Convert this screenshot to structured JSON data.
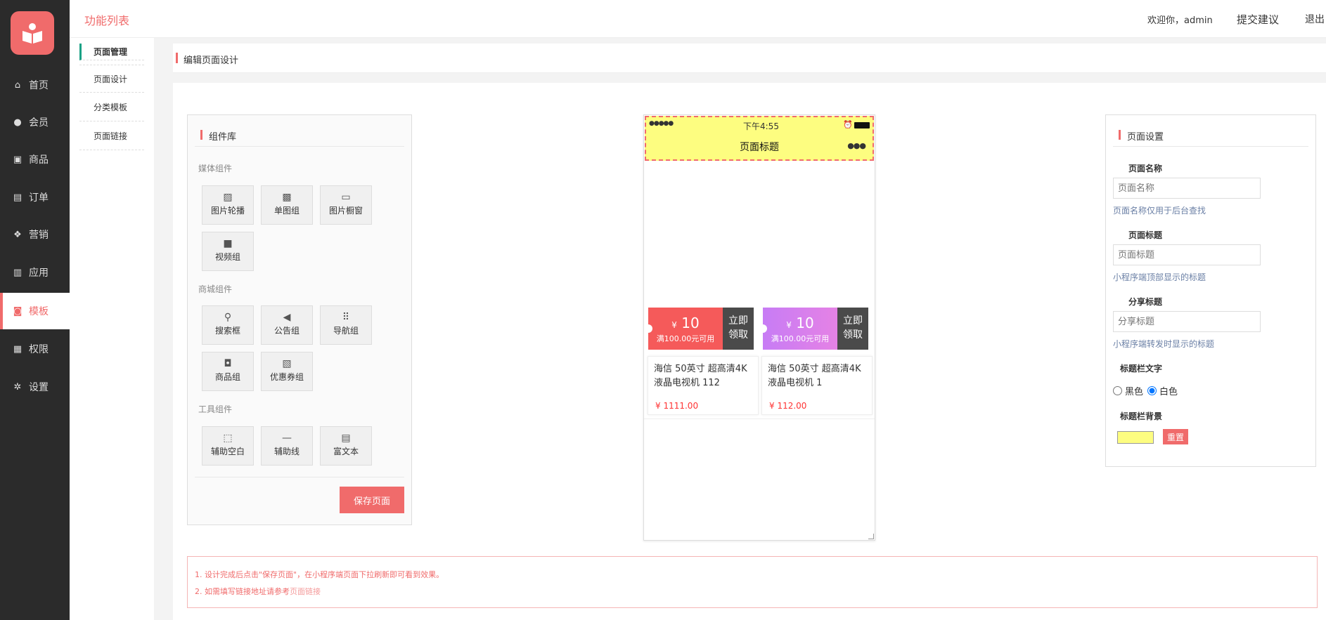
{
  "sidebar": {
    "logo_icon": "book-icon",
    "items": [
      {
        "label": "首页",
        "icon": "home-icon"
      },
      {
        "label": "会员",
        "icon": "user-icon"
      },
      {
        "label": "商品",
        "icon": "gift-icon"
      },
      {
        "label": "订单",
        "icon": "clipboard-icon"
      },
      {
        "label": "营销",
        "icon": "dropbox-icon"
      },
      {
        "label": "应用",
        "icon": "bank-icon"
      },
      {
        "label": "模板",
        "icon": "camera-icon"
      },
      {
        "label": "权限",
        "icon": "id-badge-icon"
      },
      {
        "label": "设置",
        "icon": "gear-icon"
      }
    ]
  },
  "subnav": {
    "header": "页面管理",
    "items": [
      "页面设计",
      "分类模板",
      "页面链接"
    ]
  },
  "topbar": {
    "title": "功能列表",
    "welcome": "欢迎你，admin",
    "suggest": "提交建议",
    "logout": "退出"
  },
  "breadcrumb": "编辑页面设计",
  "library": {
    "title": "组件库",
    "groups": [
      {
        "name": "媒体组件",
        "items": [
          "图片轮播",
          "单图组",
          "图片橱窗",
          "视频组"
        ]
      },
      {
        "name": "商城组件",
        "items": [
          "搜索框",
          "公告组",
          "导航组",
          "商品组",
          "优惠券组"
        ]
      },
      {
        "name": "工具组件",
        "items": [
          "辅助空白",
          "辅助线",
          "富文本"
        ]
      }
    ],
    "save_label": "保存页面"
  },
  "phone": {
    "time": "下午4:55",
    "signal": "●●●●●",
    "title": "页面标题",
    "more": "●●●",
    "coupons": [
      {
        "value": "10",
        "currency": "¥",
        "condition": "满100.00元可用",
        "action": "立即领取",
        "color": "#f55a5a"
      },
      {
        "value": "10",
        "currency": "¥",
        "condition": "满100.00元可用",
        "action": "立即领取",
        "color": "#d67ef0"
      }
    ],
    "goods": [
      {
        "name": "海信 50英寸 超高清4K 液晶电视机 112",
        "price": "¥ 1111.00"
      },
      {
        "name": "海信 50英寸 超高清4K 液晶电视机 1",
        "price": "¥ 112.00"
      }
    ]
  },
  "settings": {
    "title": "页面设置",
    "page_name_label": "页面名称",
    "page_name_placeholder": "页面名称",
    "page_name_hint": "页面名称仅用于后台查找",
    "page_title_label": "页面标题",
    "page_title_placeholder": "页面标题",
    "page_title_hint": "小程序端顶部显示的标题",
    "share_title_label": "分享标题",
    "share_title_placeholder": "分享标题",
    "share_title_hint": "小程序端转发时显示的标题",
    "text_color_label": "标题栏文字",
    "black": "黑色",
    "white": "白色",
    "bg_label": "标题栏背景",
    "bg_color": "#fdfd80",
    "reset_label": "重置"
  },
  "notes": {
    "line1": "1. 设计完成后点击\"保存页面\"，在小程序端页面下拉刷新即可看到效果。",
    "line2_prefix": "2. 如需填写链接地址请参考",
    "line2_link": "页面链接"
  }
}
